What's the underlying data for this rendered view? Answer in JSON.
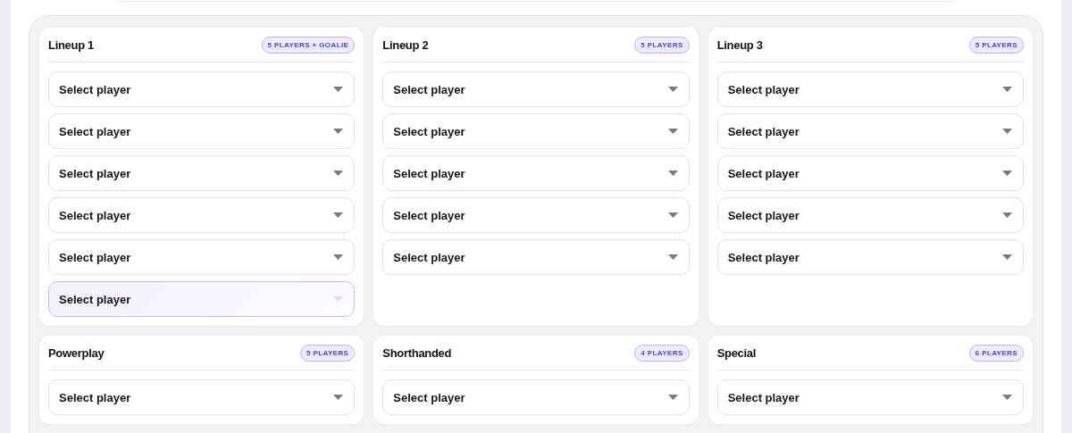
{
  "lineups": [
    {
      "title": "Lineup 1",
      "badge": "5 PLAYERS + GOALIE",
      "selects": [
        {
          "placeholder": "Select player",
          "highlighted": false
        },
        {
          "placeholder": "Select player",
          "highlighted": false
        },
        {
          "placeholder": "Select player",
          "highlighted": false
        },
        {
          "placeholder": "Select player",
          "highlighted": false
        },
        {
          "placeholder": "Select player",
          "highlighted": false
        },
        {
          "placeholder": "Select player",
          "highlighted": true
        }
      ]
    },
    {
      "title": "Lineup 2",
      "badge": "5 PLAYERS",
      "selects": [
        {
          "placeholder": "Select player",
          "highlighted": false
        },
        {
          "placeholder": "Select player",
          "highlighted": false
        },
        {
          "placeholder": "Select player",
          "highlighted": false
        },
        {
          "placeholder": "Select player",
          "highlighted": false
        },
        {
          "placeholder": "Select player",
          "highlighted": false
        }
      ]
    },
    {
      "title": "Lineup 3",
      "badge": "5 PLAYERS",
      "selects": [
        {
          "placeholder": "Select player",
          "highlighted": false
        },
        {
          "placeholder": "Select player",
          "highlighted": false
        },
        {
          "placeholder": "Select player",
          "highlighted": false
        },
        {
          "placeholder": "Select player",
          "highlighted": false
        },
        {
          "placeholder": "Select player",
          "highlighted": false
        }
      ]
    },
    {
      "title": "Powerplay",
      "badge": "5 PLAYERS",
      "selects": [
        {
          "placeholder": "Select player",
          "highlighted": false
        }
      ]
    },
    {
      "title": "Shorthanded",
      "badge": "4 PLAYERS",
      "selects": [
        {
          "placeholder": "Select player",
          "highlighted": false
        }
      ]
    },
    {
      "title": "Special",
      "badge": "6 PLAYERS",
      "selects": [
        {
          "placeholder": "Select player",
          "highlighted": false
        }
      ]
    }
  ]
}
